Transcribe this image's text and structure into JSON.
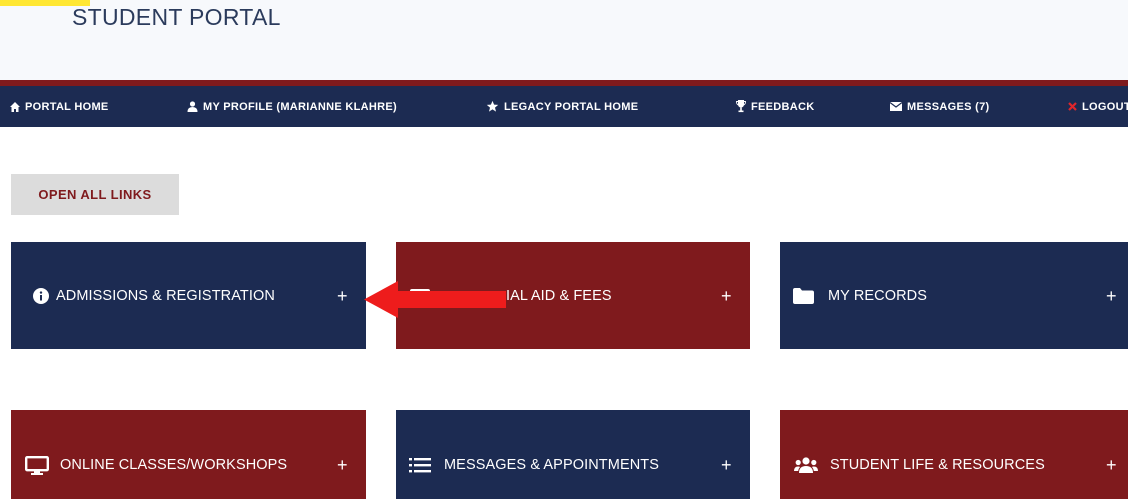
{
  "header": {
    "title": "STUDENT PORTAL"
  },
  "nav": {
    "items": [
      {
        "label": "PORTAL HOME",
        "icon": "home-icon"
      },
      {
        "label": "MY PROFILE (MARIANNE KLAHRE)",
        "icon": "user-icon"
      },
      {
        "label": "LEGACY PORTAL HOME",
        "icon": "star-icon"
      },
      {
        "label": "FEEDBACK",
        "icon": "trophy-icon"
      },
      {
        "label": "MESSAGES (7)",
        "icon": "envelope-icon"
      },
      {
        "label": "LOGOUT",
        "icon": "close-icon"
      }
    ]
  },
  "actions": {
    "open_all_label": "OPEN ALL LINKS"
  },
  "tiles": [
    {
      "label": "ADMISSIONS & REGISTRATION",
      "icon": "info-icon",
      "expand": "+"
    },
    {
      "label": "IAL AID & FEES",
      "icon": "card-icon",
      "expand": "+"
    },
    {
      "label": "MY RECORDS",
      "icon": "folder-icon",
      "expand": "+"
    },
    {
      "label": "ONLINE CLASSES/WORKSHOPS",
      "icon": "monitor-icon",
      "expand": "+"
    },
    {
      "label": "MESSAGES & APPOINTMENTS",
      "icon": "list-icon",
      "expand": "+"
    },
    {
      "label": "STUDENT LIFE & RESOURCES",
      "icon": "users-icon",
      "expand": "+"
    }
  ],
  "colors": {
    "navy": "#1c2b52",
    "crimson": "#7f1a1d",
    "button_gray": "#dcdcdc",
    "arrow_red": "#ee1c1c",
    "highlight": "#ffe733"
  }
}
